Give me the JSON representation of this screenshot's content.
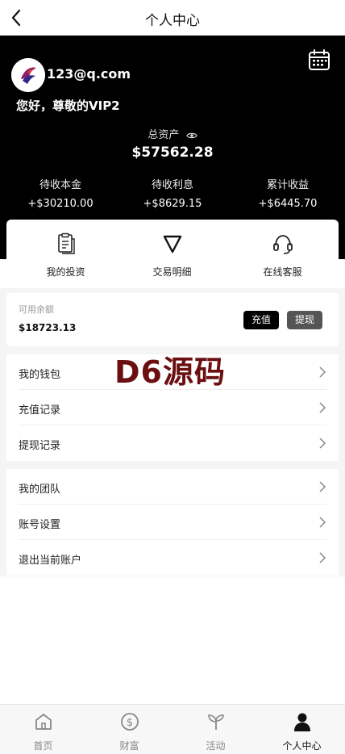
{
  "header": {
    "title": "个人中心"
  },
  "profile": {
    "email": "123@q.com",
    "greeting": "您好，尊敬的VIP2"
  },
  "assets": {
    "total_label": "总资产",
    "total_value": "$57562.28",
    "stats": [
      {
        "label": "待收本金",
        "value": "+$30210.00"
      },
      {
        "label": "待收利息",
        "value": "+$8629.15"
      },
      {
        "label": "累计收益",
        "value": "+$6445.70"
      }
    ]
  },
  "quick_links": [
    {
      "label": "我的投资",
      "icon": "clipboard-icon"
    },
    {
      "label": "交易明细",
      "icon": "triangle-icon"
    },
    {
      "label": "在线客服",
      "icon": "headset-icon"
    }
  ],
  "balance": {
    "label": "可用余额",
    "value": "$18723.13",
    "recharge": "充值",
    "withdraw": "提现"
  },
  "menu_group_1": [
    {
      "label": "我的钱包"
    },
    {
      "label": "充值记录"
    },
    {
      "label": "提现记录"
    }
  ],
  "menu_group_2": [
    {
      "label": "我的团队"
    },
    {
      "label": "账号设置"
    },
    {
      "label": "退出当前账户"
    }
  ],
  "watermark": "D6源码",
  "tabbar": [
    {
      "label": "首页",
      "icon": "home-icon"
    },
    {
      "label": "财富",
      "icon": "dollar-icon"
    },
    {
      "label": "活动",
      "icon": "sprout-icon"
    },
    {
      "label": "个人中心",
      "icon": "person-icon",
      "active": true
    }
  ]
}
